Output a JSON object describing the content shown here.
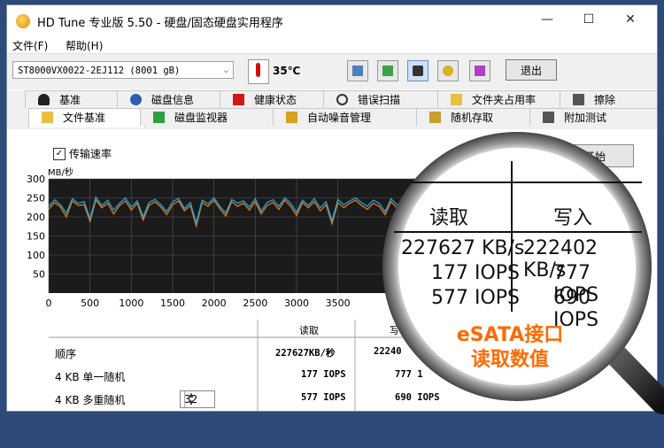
{
  "window": {
    "title": "HD Tune 专业版 5.50 - 硬盘/固态硬盘实用程序",
    "controls": [
      "—",
      "☐",
      "✕"
    ]
  },
  "menu": [
    "文件(F)",
    "帮助(H)"
  ],
  "toolbar": {
    "drive": "ST8000VX0022-2EJ112 (8001 gB)",
    "temperature": "35℃",
    "exit_label": "退出"
  },
  "tabs_top": [
    "基准",
    "磁盘信息",
    "健康状态",
    "错误扫描",
    "文件夹占用率",
    "擦除"
  ],
  "tabs_bottom": [
    "文件基准",
    "磁盘监视器",
    "自动噪音管理",
    "随机存取",
    "附加测试"
  ],
  "benchmark": {
    "checkbox_label": "传输速率",
    "start_label": "开始",
    "unit_label": "MB/秒"
  },
  "chart_data": {
    "type": "line",
    "ylabel": "MB/秒",
    "ylim": [
      0,
      300
    ],
    "yticks": [
      50,
      100,
      150,
      200,
      250,
      300
    ],
    "xlim": [
      0,
      4500
    ],
    "xticks": [
      0,
      500,
      1000,
      1500,
      2000,
      2500,
      3000,
      3500
    ],
    "grid": true,
    "series": [
      {
        "color": "#1fa3d8",
        "values": [
          228,
          245,
          232,
          210,
          248,
          236,
          240,
          195,
          252,
          230,
          244,
          218,
          236,
          250,
          226,
          242,
          200,
          238,
          246,
          232,
          214,
          240,
          249,
          222,
          238,
          184,
          244,
          235,
          250,
          228,
          210,
          246,
          236,
          242,
          226,
          248,
          215,
          238,
          245,
          228,
          250,
          236,
          212,
          244,
          230,
          248,
          224,
          240,
          190,
          246,
          232,
          242,
          250,
          238,
          228,
          244,
          236,
          214,
          248,
          232,
          240,
          246,
          226,
          244
        ]
      },
      {
        "color": "#e07a1f",
        "values": [
          220,
          238,
          226,
          200,
          242,
          230,
          232,
          188,
          245,
          224,
          236,
          208,
          230,
          242,
          218,
          236,
          192,
          230,
          240,
          226,
          206,
          232,
          242,
          216,
          230,
          176,
          238,
          228,
          244,
          222,
          202,
          240,
          228,
          236,
          218,
          240,
          208,
          230,
          238,
          220,
          244,
          228,
          204,
          238,
          224,
          240,
          216,
          232,
          182,
          238,
          224,
          236,
          244,
          230,
          220,
          236,
          228,
          206,
          240,
          224,
          232,
          238,
          218,
          236
        ]
      }
    ]
  },
  "results": {
    "header_read": "读取",
    "header_write": "写",
    "rows": [
      {
        "label": "顺序",
        "read": "227627KB/秒",
        "write": "22240"
      },
      {
        "label": "4 KB 单一随机",
        "read": "177 IOPS",
        "write": "777 1"
      },
      {
        "label": "4 KB 多重随机",
        "read": "577 IOPS",
        "write": "690 IOPS"
      }
    ],
    "queue_depth": "32"
  },
  "magnifier": {
    "read_header": "读取",
    "write_header": "写入",
    "read_seq": "227627 KB/s",
    "write_seq": "222402 KB/s",
    "read_4k": "177 IOPS",
    "write_4k": "777 IOPS",
    "read_4k_multi": "577 IOPS",
    "write_4k_multi": "690 IOPS",
    "caption_line1": "eSATA接口",
    "caption_line2": "读取数值"
  },
  "colors": {
    "background": "#2d4a78",
    "accent_orange": "#ff6a00",
    "read_line": "#1fa3d8",
    "write_line": "#e07a1f"
  }
}
